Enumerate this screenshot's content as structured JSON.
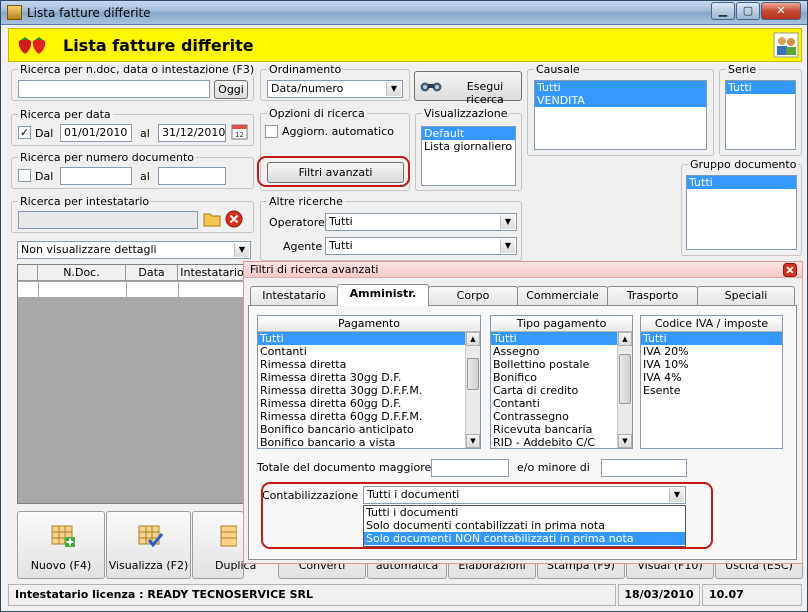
{
  "window": {
    "title": "Lista fatture differite"
  },
  "header": {
    "title": "Lista fatture differite"
  },
  "ricerca_ndoc": {
    "label": "Ricerca per n.doc, data o intestazione (F3)",
    "value": "",
    "oggi_label": "Oggi"
  },
  "ordinamento": {
    "label": "Ordinamento",
    "value": "Data/numero"
  },
  "esegui": {
    "label": "Esegui ricerca"
  },
  "causale": {
    "label": "Causale",
    "items": [
      "Tutti",
      "VENDITA"
    ]
  },
  "serie": {
    "label": "Serie",
    "items": [
      "Tutti"
    ]
  },
  "ricerca_data": {
    "label": "Ricerca per data",
    "dal_label": "Dal",
    "dal_checked": "✓",
    "dal_value": "01/01/2010",
    "al_label": "al",
    "al_value": "31/12/2010"
  },
  "opzioni": {
    "label": "Opzioni di ricerca",
    "aggiorn_label": "Aggiorn. automatico",
    "filtri_label": "Filtri avanzati"
  },
  "visualizzazione": {
    "label": "Visualizzazione",
    "items": [
      "Default",
      "Lista giornaliero"
    ]
  },
  "ricerca_numero": {
    "label": "Ricerca per numero documento",
    "dal_label": "Dal",
    "al_label": "al"
  },
  "gruppo": {
    "label": "Gruppo documento",
    "items": [
      "Tutti"
    ]
  },
  "ricerca_intestatario": {
    "label": "Ricerca per intestatario",
    "value": ""
  },
  "altre": {
    "label": "Altre ricerche",
    "operatore_label": "Operatore :",
    "operatore_value": "Tutti",
    "agente_label": "Agente :",
    "agente_value": "Tutti"
  },
  "dettagli": {
    "value": "Non visualizzare dettagli"
  },
  "grid": {
    "columns": [
      "N.Doc.",
      "Data",
      "Intestatario"
    ]
  },
  "adv": {
    "title": "Filtri di ricerca avanzati",
    "tabs": [
      "Intestatario",
      "Amministr.",
      "Corpo",
      "Commerciale",
      "Trasporto",
      "Speciali"
    ],
    "pagamento": {
      "header": "Pagamento",
      "items": [
        "Tutti",
        "Contanti",
        "Rimessa diretta",
        "Rimessa diretta 30gg D.F.",
        "Rimessa diretta 30gg D.F.F.M.",
        "Rimessa diretta 60gg D.F.",
        "Rimessa diretta 60gg D.F.F.M.",
        "Bonifico bancario anticipato",
        "Bonifico bancario a vista"
      ]
    },
    "tipo_pagamento": {
      "header": "Tipo pagamento",
      "items": [
        "Tutti",
        "Assegno",
        "Bollettino postale",
        "Bonifico",
        "Carta di credito",
        "Contanti",
        "Contrassegno",
        "Ricevuta bancaria",
        "RID - Addebito C/C"
      ]
    },
    "codice_iva": {
      "header": "Codice IVA / imposte",
      "items": [
        "Tutti",
        "IVA 20%",
        "IVA 10%",
        "IVA 4%",
        "Esente"
      ]
    },
    "totale_label": "Totale del documento maggiore di",
    "minore_label": "e/o minore di",
    "contab_label": "Contabilizzazione :",
    "contab_value": "Tutti i documenti",
    "contab_options": [
      "Tutti i documenti",
      "Solo documenti contabilizzati in prima nota",
      "Solo documenti NON contabilizzati in prima nota"
    ]
  },
  "toolbar": {
    "nuovo": "Nuovo (F4)",
    "visualizza": "Visualizza (F2)",
    "duplica": "Duplica",
    "converti": "Converti",
    "fatt": "Fatt. automatica",
    "elaborazioni": "Elaborazioni",
    "stampa": "Stampa (F9)",
    "visual": "Visual (F10)",
    "uscita": "Uscita (ESC)"
  },
  "status": {
    "licenza": "Intestatario licenza : READY TECNOSERVICE SRL",
    "data": "18/03/2010",
    "versione": "10.07"
  },
  "colors": {
    "header_bg": "#fff700",
    "selection": "#3399ff",
    "highlight_oval": "#c41a1a"
  }
}
